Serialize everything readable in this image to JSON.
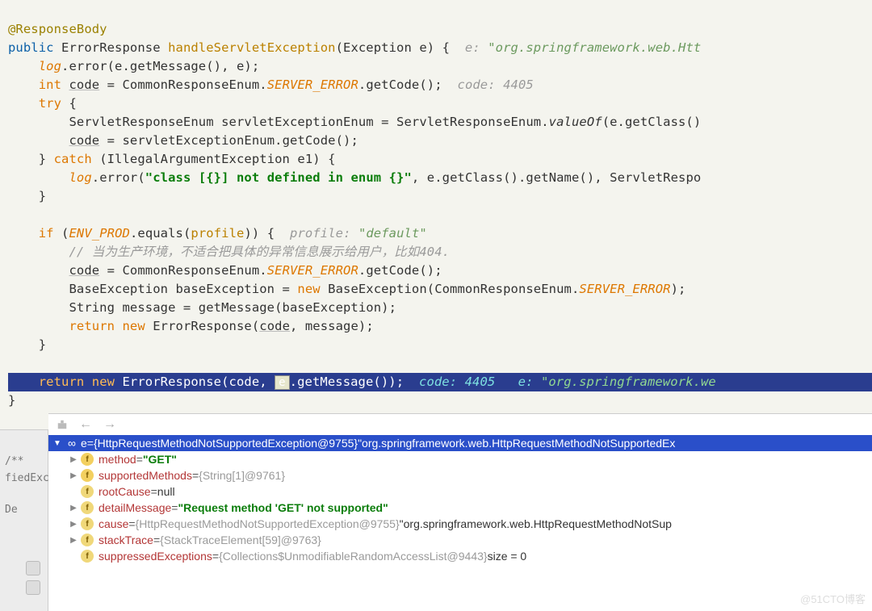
{
  "code": {
    "l1_annot": "@ResponseBody",
    "l2_kw": "public",
    "l2_type": "ErrorResponse ",
    "l2_method": "handleServletException",
    "l2_params": "(Exception e) {  ",
    "l2_hint_prefix": "e: ",
    "l2_hint_val": "\"org.springframework.web.Htt",
    "l3_a": "    ",
    "l3_log": "log",
    "l3_b": ".error(e.getMessage(), e);",
    "l4_a": "    ",
    "l4_int": "int",
    "l4_b": " ",
    "l4_code": "code",
    "l4_c": " = CommonResponseEnum.",
    "l4_const": "SERVER_ERROR",
    "l4_d": ".getCode();  ",
    "l4_hint": "code: 4405",
    "l5_a": "    ",
    "l5_try": "try",
    "l5_b": " {",
    "l6_a": "        ServletResponseEnum servletExceptionEnum = ServletResponseEnum.",
    "l6_valueof": "valueOf",
    "l6_b": "(e.getClass()",
    "l7_a": "        ",
    "l7_code": "code",
    "l7_b": " = servletExceptionEnum.getCode();",
    "l8_a": "    } ",
    "l8_catch": "catch",
    "l8_b": " (IllegalArgumentException e1) {",
    "l9_a": "        ",
    "l9_log": "log",
    "l9_b": ".error(",
    "l9_str": "\"class [{}] not defined in enum {}\"",
    "l9_c": ", e.getClass().getName(), ServletRespo",
    "l10": "    }",
    "l11": "",
    "l12_a": "    ",
    "l12_if": "if",
    "l12_b": " (",
    "l12_env": "ENV_PROD",
    "l12_c": ".equals(",
    "l12_profile": "profile",
    "l12_d": ")) {  ",
    "l12_hint_p": "profile: ",
    "l12_hint_v": "\"default\"",
    "l13_a": "        ",
    "l13_comment": "// 当为生产环境，不适合把具体的异常信息展示给用户，比如404.",
    "l14_a": "        ",
    "l14_code": "code",
    "l14_b": " = CommonResponseEnum.",
    "l14_const": "SERVER_ERROR",
    "l14_c": ".getCode();",
    "l15_a": "        BaseException baseException = ",
    "l15_new": "new",
    "l15_b": " BaseException(CommonResponseEnum.",
    "l15_const": "SERVER_ERROR",
    "l15_c": ");",
    "l16_a": "        String message = getMessage(baseException);",
    "l17_a": "        ",
    "l17_ret": "return",
    "l17_b": " ",
    "l17_new": "new",
    "l17_c": " ErrorResponse(",
    "l17_code": "code",
    "l17_d": ", message);",
    "l18": "    }",
    "l19": "",
    "hl_a": "    ",
    "hl_ret": "return",
    "hl_b": " ",
    "hl_new": "new",
    "hl_c": " ErrorResponse(code, ",
    "hl_e": "e",
    "hl_d": ".getMessage());  ",
    "hl_hint1": "code: 4405",
    "hl_sep": "   ",
    "hl_hint2a": "e: ",
    "hl_hint2b": "\"org.springframework.we",
    "l21": "}",
    "e_popup": "e"
  },
  "gutter": {
    "doc": "/**",
    "fied": "fiedExc",
    "de": "De"
  },
  "debug": {
    "root_name": "e",
    "root_eq": " = ",
    "root_type": "{HttpRequestMethodNotSupportedException@9755}",
    "root_val": " \"org.springframework.web.HttpRequestMethodNotSupportedEx",
    "method_name": "method",
    "method_eq": " = ",
    "method_val": "\"GET\"",
    "supported_name": "supportedMethods",
    "supported_eq": " = ",
    "supported_val": "{String[1]@9761}",
    "root_cause_name": "rootCause",
    "root_cause_eq": " = ",
    "root_cause_val": "null",
    "detail_name": "detailMessage",
    "detail_eq": " = ",
    "detail_val": "\"Request method 'GET' not supported\"",
    "cause_name": "cause",
    "cause_eq": " = ",
    "cause_type": "{HttpRequestMethodNotSupportedException@9755}",
    "cause_val": " \"org.springframework.web.HttpRequestMethodNotSup",
    "stack_name": "stackTrace",
    "stack_eq": " = ",
    "stack_val": "{StackTraceElement[59]@9763}",
    "suppr_name": "suppressedExceptions",
    "suppr_eq": " = ",
    "suppr_type": "{Collections$UnmodifiableRandomAccessList@9443}",
    "suppr_size": "  size = 0"
  },
  "watermark": "@51CTO博客"
}
